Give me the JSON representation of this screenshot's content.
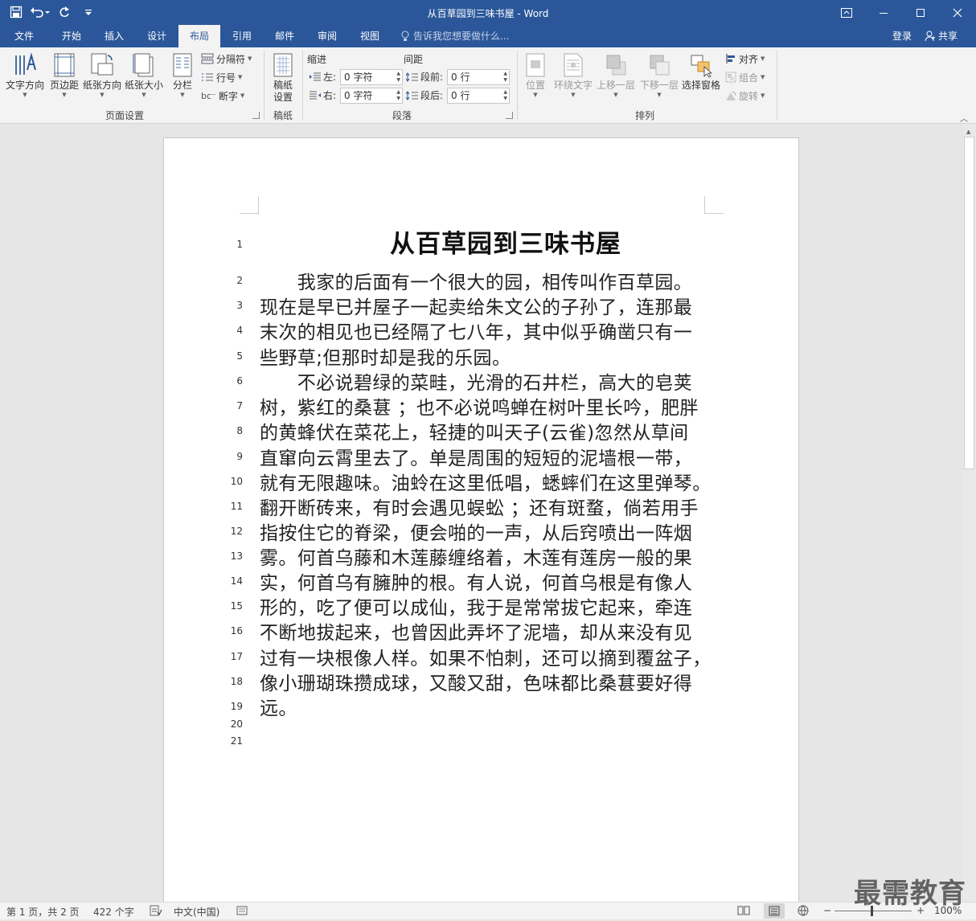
{
  "window": {
    "title": "从百草园到三味书屋 - Word",
    "accent_color": "#2b579a"
  },
  "qat": {
    "save_icon": "save-icon",
    "undo_icon": "undo-icon",
    "redo_icon": "redo-icon",
    "customize_icon": "customize-qat-icon"
  },
  "tabs": [
    {
      "label": "文件"
    },
    {
      "label": "开始"
    },
    {
      "label": "插入"
    },
    {
      "label": "设计"
    },
    {
      "label": "布局",
      "active": true
    },
    {
      "label": "引用"
    },
    {
      "label": "邮件"
    },
    {
      "label": "审阅"
    },
    {
      "label": "视图"
    }
  ],
  "tellme": {
    "placeholder": "告诉我您想要做什么..."
  },
  "account": {
    "login": "登录",
    "share": "共享"
  },
  "ribbon": {
    "page_setup": {
      "label": "页面设置",
      "text_direction": "文字方向",
      "margins": "页边距",
      "orientation": "纸张方向",
      "size": "纸张大小",
      "columns": "分栏",
      "breaks": "分隔符",
      "line_numbers": "行号",
      "hyphenation": "断字"
    },
    "manuscript": {
      "label": "稿纸",
      "setup_line1": "稿纸",
      "setup_line2": "设置"
    },
    "paragraph": {
      "label": "段落",
      "indent_title": "缩进",
      "spacing_title": "间距",
      "left_label": "左:",
      "right_label": "右:",
      "before_label": "段前:",
      "after_label": "段后:",
      "left_value": "0 字符",
      "right_value": "0 字符",
      "before_value": "0 行",
      "after_value": "0 行"
    },
    "arrange": {
      "label": "排列",
      "position": "位置",
      "wrap_text": "环绕文字",
      "bring_forward": "上移一层",
      "send_backward": "下移一层",
      "selection_pane": "选择窗格",
      "align": "对齐",
      "group": "组合",
      "rotate": "旋转"
    }
  },
  "document": {
    "title": "从百草园到三味书屋",
    "line_numbers": [
      "1",
      "2",
      "3",
      "4",
      "5",
      "6",
      "7",
      "8",
      "9",
      "10",
      "11",
      "12",
      "13",
      "14",
      "15",
      "16",
      "17",
      "18",
      "19",
      "20",
      "21"
    ],
    "lines": [
      "　　我家的后面有一个很大的园，相传叫作百草园。",
      "现在是早已并屋子一起卖给朱文公的子孙了，连那最",
      "末次的相见也已经隔了七八年，其中似乎确凿只有一",
      "些野草;但那时却是我的乐园。",
      "　　不必说碧绿的菜畦，光滑的石井栏，高大的皂荚",
      "树，紫红的桑葚 ；也不必说鸣蝉在树叶里长吟，肥胖",
      "的黄蜂伏在菜花上，轻捷的叫天子(云雀)忽然从草间",
      "直窜向云霄里去了。单是周围的短短的泥墙根一带，",
      "就有无限趣味。油蛉在这里低唱，蟋蟀们在这里弹琴。",
      "翻开断砖来，有时会遇见蜈蚣 ；还有斑蝥，倘若用手",
      "指按住它的脊梁，便会啪的一声，从后窍喷出一阵烟",
      "雾。何首乌藤和木莲藤缠络着，木莲有莲房一般的果",
      "实，何首乌有臃肿的根。有人说，何首乌根是有像人",
      "形的，吃了便可以成仙，我于是常常拔它起来，牵连",
      "不断地拔起来，也曾因此弄坏了泥墙，却从来没有见",
      "过有一块根像人样。如果不怕刺，还可以摘到覆盆子，",
      "像小珊瑚珠攒成球，又酸又甜，色味都比桑葚要好得",
      "远。"
    ]
  },
  "status": {
    "page": "第 1 页，共 2 页",
    "words": "422 个字",
    "language": "中文(中国)",
    "zoom": "100%"
  },
  "watermark": "最需教育"
}
